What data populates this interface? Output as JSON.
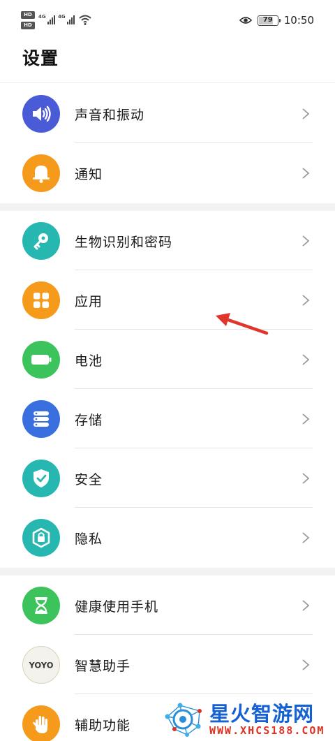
{
  "status_bar": {
    "hd_1": "HD",
    "hd_2": "HD",
    "net_1": "4G",
    "net_2": "4G",
    "battery": "79",
    "battery_level_percent": 79,
    "time": "10:50"
  },
  "page": {
    "title": "设置"
  },
  "groups": [
    {
      "items": [
        {
          "id": "sound",
          "label": "声音和振动",
          "icon": "speaker-icon",
          "color": "#4a5bd8"
        },
        {
          "id": "notifications",
          "label": "通知",
          "icon": "bell-icon",
          "color": "#f59a1b"
        }
      ]
    },
    {
      "items": [
        {
          "id": "biometrics",
          "label": "生物识别和密码",
          "icon": "key-icon",
          "color": "#26b8b0"
        },
        {
          "id": "apps",
          "label": "应用",
          "icon": "apps-grid-icon",
          "color": "#f59a1b"
        },
        {
          "id": "battery",
          "label": "电池",
          "icon": "battery-icon",
          "color": "#3cc35c"
        },
        {
          "id": "storage",
          "label": "存储",
          "icon": "storage-icon",
          "color": "#3a6fe0"
        },
        {
          "id": "security",
          "label": "安全",
          "icon": "shield-check-icon",
          "color": "#26b8b0"
        },
        {
          "id": "privacy",
          "label": "隐私",
          "icon": "lock-icon",
          "color": "#26b8b0"
        }
      ]
    },
    {
      "items": [
        {
          "id": "digital_balance",
          "label": "健康使用手机",
          "icon": "hourglass-icon",
          "color": "#3cc35c"
        },
        {
          "id": "assistant",
          "label": "智慧助手",
          "icon": "yoyo-icon",
          "icon_text": "YOYO",
          "color": "#e8e4d8"
        },
        {
          "id": "accessibility",
          "label": "辅助功能",
          "icon": "hand-icon",
          "color": "#f59a1b"
        }
      ]
    }
  ],
  "annotation": {
    "icon": "red-arrow-icon",
    "color": "#e0352b"
  },
  "watermark": {
    "title": "星火智游网",
    "url": "WWW.XHCS188.COM",
    "logo": "network-logo-icon"
  }
}
